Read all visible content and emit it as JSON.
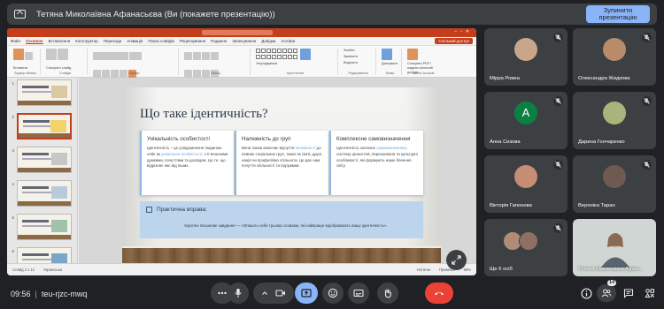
{
  "banner": {
    "title": "Тетяна Миколаївна Афанасьєва (Ви (покажете презентацію))",
    "stop_label": "Зупинити презентацію"
  },
  "ppt": {
    "window_title": "Урок 3 — PowerPoint",
    "search_placeholder": "Пошук",
    "tabs": [
      "Файл",
      "Основне",
      "Вставлення",
      "Конструктор",
      "Переходи",
      "Анімація",
      "Показ слайдів",
      "Рецензування",
      "Подання",
      "Записування",
      "Довідка",
      "Acrobat"
    ],
    "active_tab": "Основне",
    "share_label": "Спільний доступ",
    "ribbon_groups": [
      "Буфер обміну",
      "Слайди",
      "Шрифт",
      "Абзац",
      "Креслення",
      "Редагування",
      "Мова",
      "Adobe Acrobat"
    ],
    "ribbon_texts": {
      "paste": "Вставити",
      "new_slide": "Створити слайд",
      "reuse": "Повторне використання",
      "arrange": "Упорядкувати",
      "quick_styles": "Експрес-стилі",
      "find": "Знайти",
      "replace": "Замінити",
      "select": "Виділити",
      "dictate": "Диктувати",
      "create_pdf": "Створити PDF і надати спільний доступ"
    },
    "thumbnail_numbers": [
      "1",
      "2",
      "3",
      "4",
      "5",
      "6"
    ],
    "status": {
      "slide_info": "Слайд 2 з 12",
      "language": "Українська",
      "notes": "Нотатки",
      "comments": "Примітки",
      "zoom": "68%"
    }
  },
  "slide": {
    "title": "Що таке ідентичність?",
    "cards": [
      {
        "title": "Унікальність особистості",
        "body_parts": [
          "Ідентичність – це усвідомлення людиною себе як ",
          "унікальної особистості",
          ", з її власними думками, почуттями та досвідом. Це те, що відрізняє нас від інших."
        ]
      },
      {
        "title": "Належність до груп",
        "body_parts": [
          "Вона також включає відчуття ",
          "належності",
          " до певних соціальних груп, таких як сім'я, друзі, нація чи професійна спільнота. Це дає нам почуття спільності та підтримки."
        ]
      },
      {
        "title": "Комплексне самовизначення",
        "body_parts": [
          "Ідентичність охоплює ",
          "самовизначення",
          ", систему цінностей, переконання та культурні особливості, які формують наше бачення світу."
        ]
      }
    ],
    "practice": {
      "title": "Практична вправа:",
      "text": "Коротке письмове завдання — «Опишіть себе трьома словами, які найкраще відображають вашу ідентичність»."
    }
  },
  "participants": [
    {
      "name": "Мірра Рожка",
      "muted": true,
      "avatar_color": "#c9a58a"
    },
    {
      "name": "Олександра Жидкова",
      "muted": true,
      "avatar_color": "#b88c6a"
    },
    {
      "name": "Анна Сизова",
      "muted": true,
      "avatar_letter": "А",
      "avatar_color": "#0b8043"
    },
    {
      "name": "Дарина Гончаренко",
      "muted": true,
      "avatar_color": "#a9b47c"
    },
    {
      "name": "Вікторія Гапонова",
      "muted": true,
      "avatar_color": "#c58d73"
    },
    {
      "name": "Вероніка Таран",
      "muted": true,
      "avatar_color": "#6f5a52"
    },
    {
      "name": "Ще 6 осіб",
      "muted": true,
      "avatar_colors": [
        "#b08c78",
        "#8e6f63"
      ]
    },
    {
      "name": "Тетяна Миколаївна Афан...",
      "muted": false,
      "self": true
    }
  ],
  "bottom_bar": {
    "time": "09:56",
    "meeting_code": "teu-rjzc-mwq",
    "participant_count": "14",
    "icons": [
      "more-options-icon",
      "microphone-icon",
      "camera-icon",
      "present-icon",
      "emoji-icon",
      "captions-icon",
      "raise-hand-icon",
      "end-call-icon",
      "info-icon",
      "people-icon",
      "chat-icon",
      "activities-icon"
    ]
  },
  "colors": {
    "background": "#202124",
    "tile": "#3c4043",
    "accent": "#8ab4f8",
    "end_call": "#ea4335",
    "ppt_brand": "#c43e1c"
  }
}
